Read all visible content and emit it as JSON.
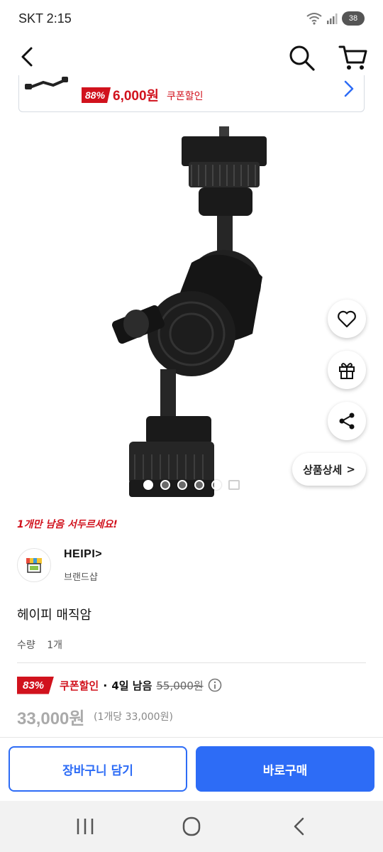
{
  "status_bar": {
    "carrier": "SKT 2:15",
    "battery": "38"
  },
  "banner": {
    "discount_pct": "88%",
    "price": "6,000원",
    "label": "쿠폰할인"
  },
  "product": {
    "stock_alert": "1개만 남음 서두르세요!",
    "brand_name": "HEIPI>",
    "brand_type": "브랜드샵",
    "title": "헤이피 매직암",
    "quantity_label": "수량",
    "quantity_value": "1개",
    "discount_pct": "83%",
    "coupon_label": "쿠폰할인",
    "separator": "·",
    "remaining": "4일 남음",
    "original_price": "55,000원",
    "final_price": "33,000원",
    "unit_price": "(1개당 33,000원)"
  },
  "detail_button": {
    "label": "상품상세",
    "chevron": ">"
  },
  "actions": {
    "add_to_cart": "장바구니 담기",
    "buy_now": "바로구매"
  },
  "colors": {
    "accent_blue": "#2d6cf6",
    "discount_red": "#d1121d"
  },
  "icons": [
    "back-icon",
    "search-icon",
    "cart-icon",
    "heart-icon",
    "gift-icon",
    "share-icon",
    "info-icon",
    "recent-apps-icon",
    "home-icon",
    "back-nav-icon"
  ],
  "carousel": {
    "dot_count": 5,
    "active_index": 0
  }
}
